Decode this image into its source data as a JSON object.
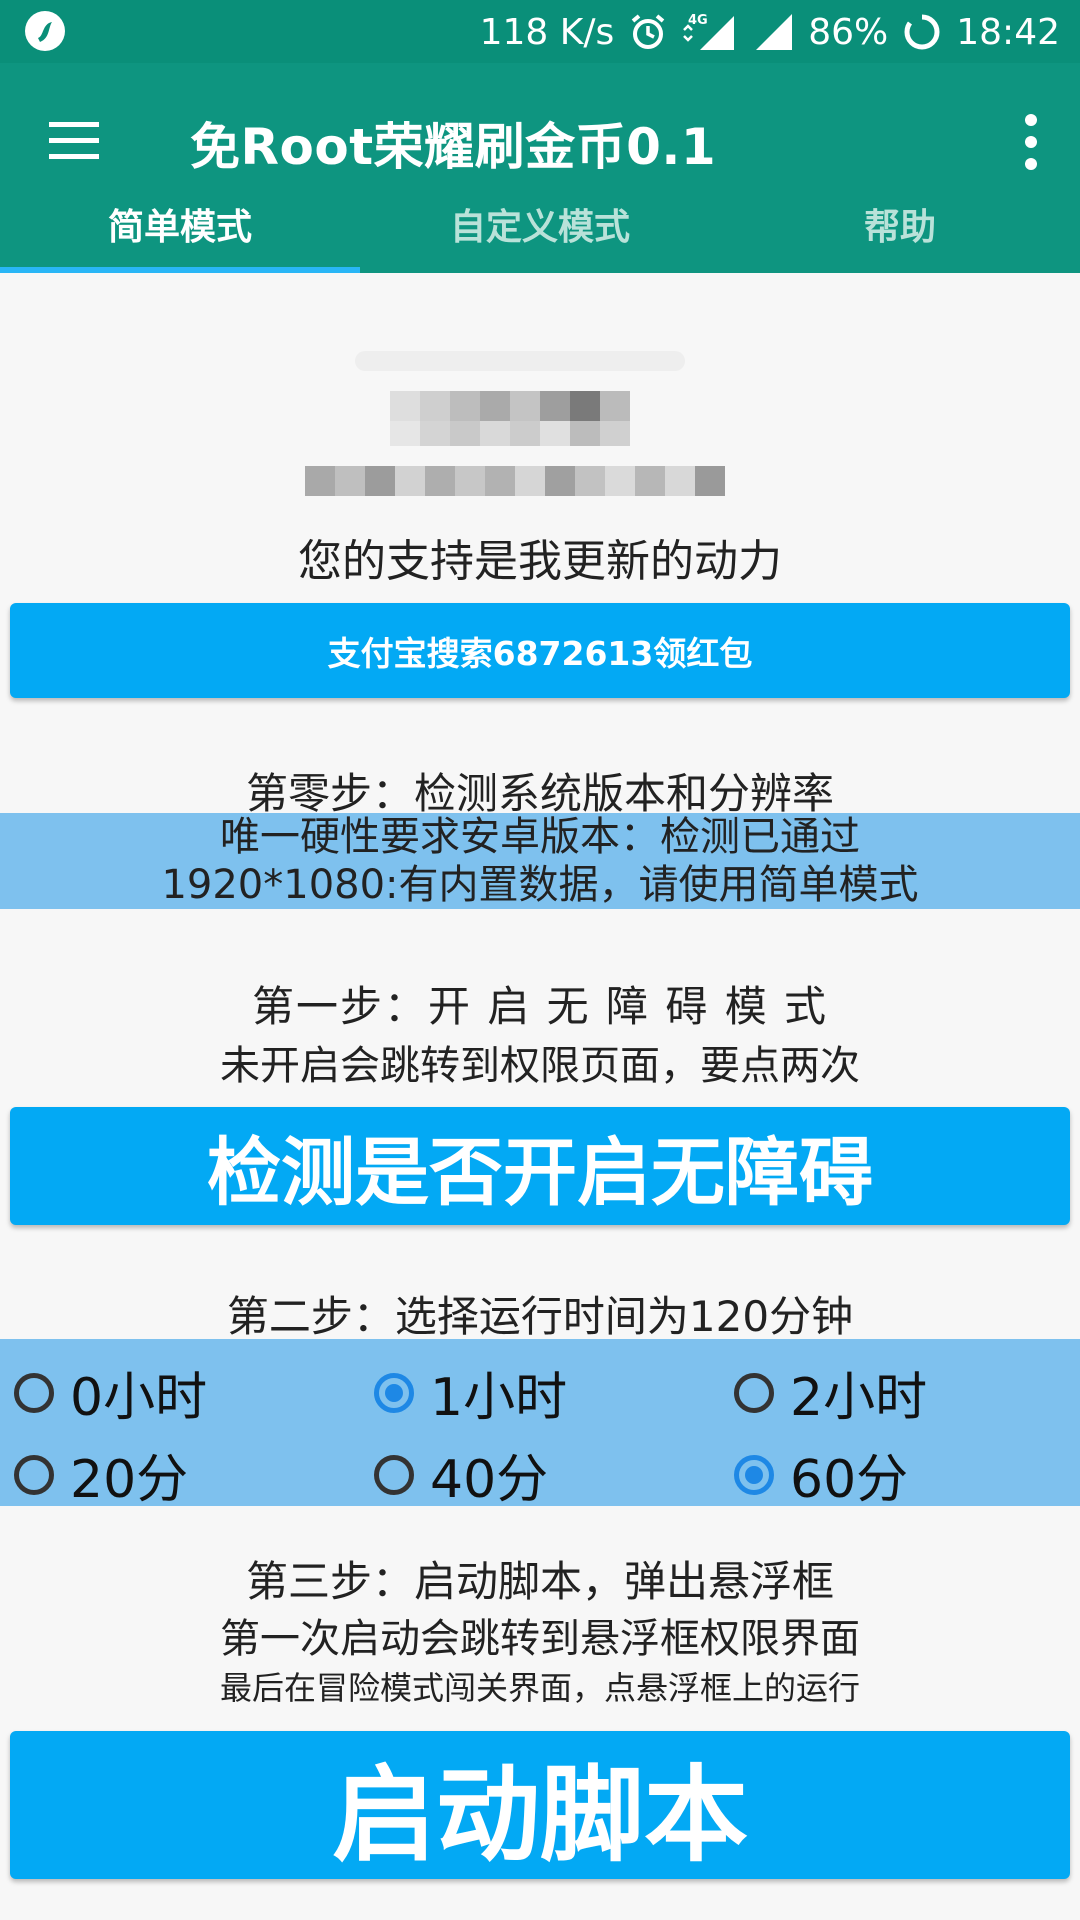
{
  "status_bar": {
    "net_speed": "118 K/s",
    "network": "4G",
    "battery": "86%",
    "time": "18:42",
    "icons": [
      "app-notification-icon",
      "alarm-icon",
      "network-4g-icon",
      "signal-icon",
      "signal-icon-2",
      "battery-ring-icon"
    ]
  },
  "app_bar": {
    "title": "免Root荣耀刷金币0.1",
    "menu_icon": "hamburger-menu-icon",
    "more_icon": "more-vert-icon",
    "color": "#0e9580"
  },
  "tabs": [
    {
      "label": "简单模式",
      "active": true
    },
    {
      "label": "自定义模式",
      "active": false
    },
    {
      "label": "帮助",
      "active": false
    }
  ],
  "support": {
    "text": "您的支持是我更新的动力",
    "button_label": "支付宝搜索6872613领红包"
  },
  "step0": {
    "title": "第零步：检测系统版本和分辨率",
    "lines": [
      "唯一硬性要求安卓版本：检测已通过",
      "1920*1080:有内置数据，请使用简单模式"
    ]
  },
  "step1": {
    "title": "第一步：开 启 无 障 碍 模 式",
    "subtitle": "未开启会跳转到权限页面，要点两次",
    "button_label": "检测是否开启无障碍"
  },
  "step2": {
    "title": "第二步：选择运行时间为120分钟",
    "hours": [
      {
        "label": "0小时",
        "checked": false
      },
      {
        "label": "1小时",
        "checked": true
      },
      {
        "label": "2小时",
        "checked": false
      }
    ],
    "minutes": [
      {
        "label": "20分",
        "checked": false
      },
      {
        "label": "40分",
        "checked": false
      },
      {
        "label": "60分",
        "checked": true
      }
    ]
  },
  "step3": {
    "title": "第三步：启动脚本，弹出悬浮框",
    "subtitle1": "第一次启动会跳转到悬浮框权限界面",
    "subtitle2": "最后在冒险模式闯关界面，点悬浮框上的运行",
    "button_label": "启动脚本"
  },
  "colors": {
    "accent_button": "#03a9f4",
    "band": "#7ec1ee",
    "radio_checked": "#1e88e5"
  }
}
